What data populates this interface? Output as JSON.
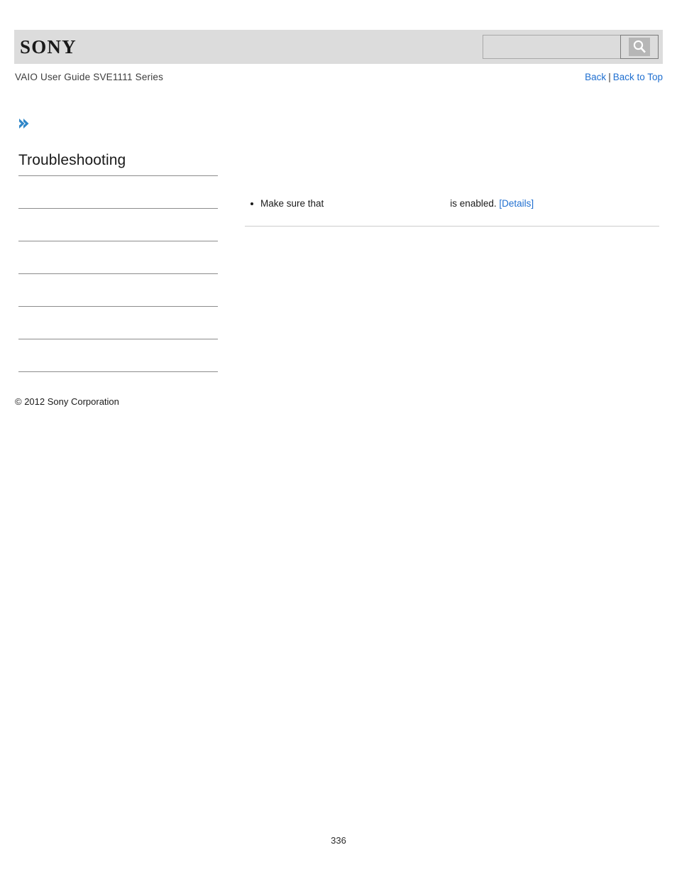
{
  "header": {
    "logo_text": "SONY",
    "search": {
      "value": "",
      "placeholder": "",
      "icon": "search-icon",
      "button_label": ""
    }
  },
  "subheader": {
    "doc_title": "VAIO User Guide SVE1111 Series",
    "back_label": "Back",
    "separator": "|",
    "back_to_top_label": "Back to Top"
  },
  "marker": {
    "icon": "double-chevron-right-icon"
  },
  "sidebar": {
    "title": "Troubleshooting",
    "items": [
      {
        "label": ""
      },
      {
        "label": ""
      },
      {
        "label": ""
      },
      {
        "label": ""
      },
      {
        "label": ""
      },
      {
        "label": ""
      }
    ]
  },
  "main": {
    "bullets": [
      {
        "text_before": "Make sure that",
        "blank": "",
        "text_after": "is enabled.",
        "link_label": "[Details]"
      }
    ]
  },
  "footer": {
    "copyright": "© 2012 Sony Corporation",
    "page_number": "336"
  },
  "colors": {
    "header_bar": "#dcdcdc",
    "link_blue": "#1f6fd0",
    "chevron_blue": "#2e86c8",
    "rule_gray": "#8c8c8c",
    "content_rule": "#cccccc",
    "text": "#1a1a1a"
  }
}
